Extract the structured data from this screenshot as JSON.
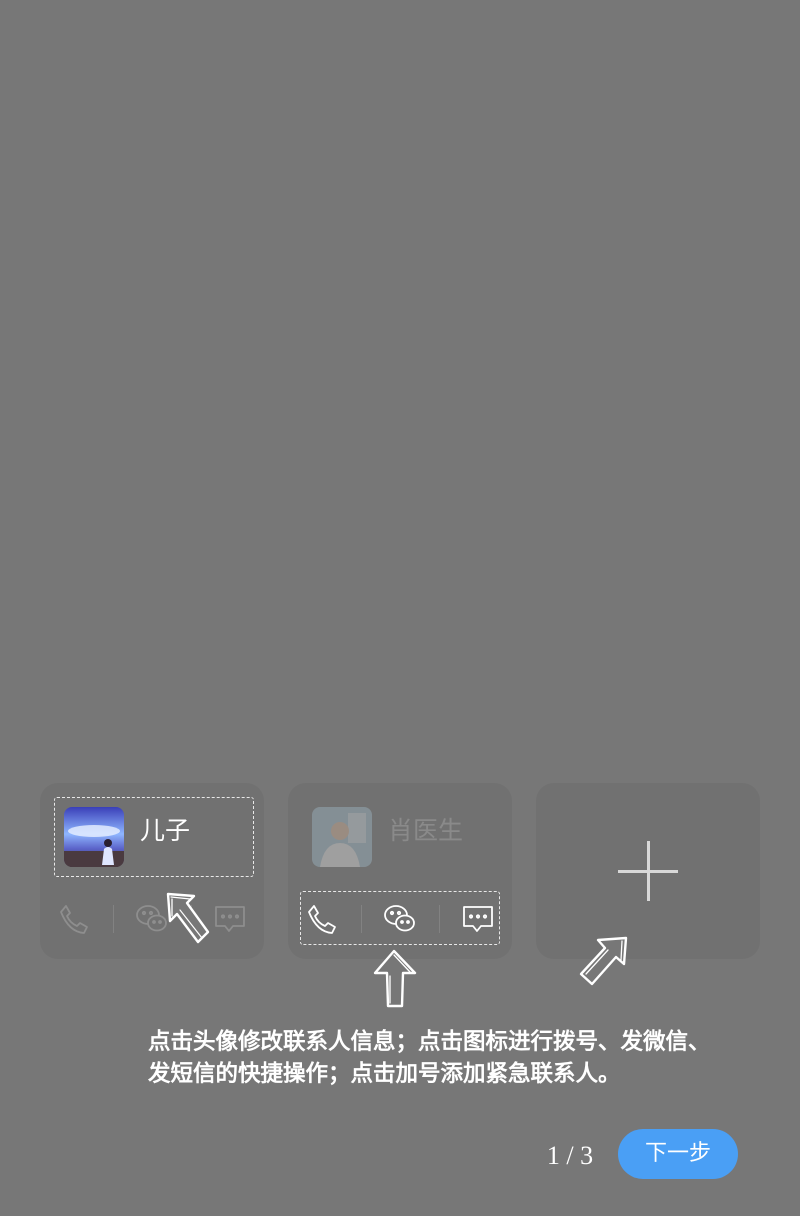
{
  "contacts": [
    {
      "name": "儿子",
      "avatar": "son-photo"
    },
    {
      "name": "肖医生",
      "avatar": "doctor-photo"
    }
  ],
  "add_contact": {
    "icon": "plus-icon"
  },
  "actions": [
    "phone-icon",
    "wechat-icon",
    "message-icon"
  ],
  "guide_text": {
    "line1": "点击头像修改联系人信息；点击图标进行拨号、发微信、",
    "line2": "发短信的快捷操作；点击加号添加紧急联系人。"
  },
  "pager": {
    "text": "1 / 3"
  },
  "next_button": {
    "label": "下一步"
  },
  "colors": {
    "overlay": "#777777",
    "card": "#717171",
    "next_button": "#4a9ff5"
  }
}
